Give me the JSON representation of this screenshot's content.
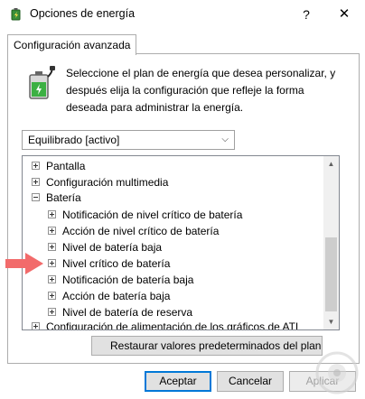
{
  "window": {
    "title": "Opciones de energía",
    "help_label": "?",
    "close_label": "✕"
  },
  "tab": {
    "label": "Configuración avanzada"
  },
  "description": "Seleccione el plan de energía que desea personalizar, y después elija la configuración que refleje la forma deseada para administrar la energía.",
  "plan_select": {
    "selected": "Equilibrado [activo]"
  },
  "tree": {
    "items": [
      {
        "label": "Pantalla",
        "expanded": false,
        "level": 0
      },
      {
        "label": "Configuración multimedia",
        "expanded": false,
        "level": 0
      },
      {
        "label": "Batería",
        "expanded": true,
        "level": 0
      },
      {
        "label": "Notificación de nivel crítico de batería",
        "expanded": false,
        "level": 1
      },
      {
        "label": "Acción de nivel crítico de batería",
        "expanded": false,
        "level": 1
      },
      {
        "label": "Nivel de batería baja",
        "expanded": false,
        "level": 1
      },
      {
        "label": "Nivel crítico de batería",
        "expanded": false,
        "level": 1
      },
      {
        "label": "Notificación de batería baja",
        "expanded": false,
        "level": 1
      },
      {
        "label": "Acción de batería baja",
        "expanded": false,
        "level": 1
      },
      {
        "label": "Nivel de batería de reserva",
        "expanded": false,
        "level": 1
      },
      {
        "label": "Configuración de alimentación de los gráficos de ATI",
        "expanded": false,
        "level": 0
      }
    ]
  },
  "buttons": {
    "restore": "Restaurar valores predeterminados del plan",
    "accept": "Aceptar",
    "cancel": "Cancelar",
    "apply": "Aplicar"
  },
  "colors": {
    "annotation_arrow": "#f26b6b",
    "window_bg": "#ffffff",
    "button_bg": "#e1e1e1",
    "focus_border": "#0078d7"
  }
}
